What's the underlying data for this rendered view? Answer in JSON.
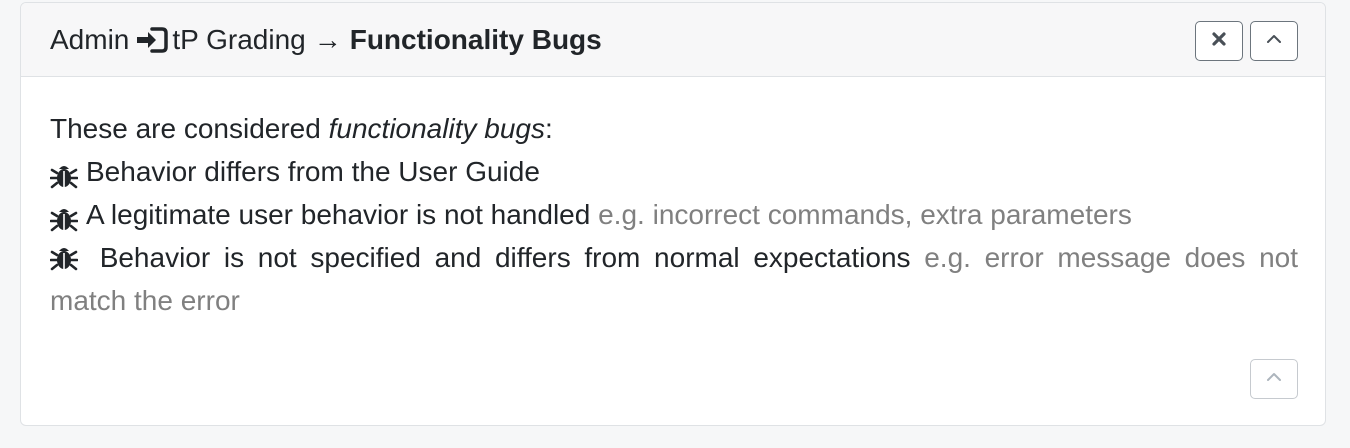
{
  "header": {
    "crumb_admin": "Admin",
    "crumb_grading": "tP Grading",
    "arrow": "→",
    "title": "Functionality Bugs",
    "close_icon": "times-icon",
    "collapse_icon": "chevron-up-icon"
  },
  "body": {
    "intro_prefix": "These are considered ",
    "intro_emphasis": "functionality bugs",
    "intro_suffix": ":",
    "bug_icon": "bug-icon",
    "items": [
      {
        "text": "Behavior differs from the User Guide",
        "example": ""
      },
      {
        "text": "A legitimate user behavior is not handled",
        "example": "e.g. incorrect commands, extra parameters"
      },
      {
        "text": "Behavior is not specified and differs from normal expectations",
        "example": "e.g. error message does not match the error"
      }
    ]
  },
  "footer": {
    "scroll_top_icon": "chevron-up-icon"
  },
  "colors": {
    "muted_text": "#808080",
    "header_bg": "#f7f7f8",
    "border": "#dfe2e5"
  }
}
